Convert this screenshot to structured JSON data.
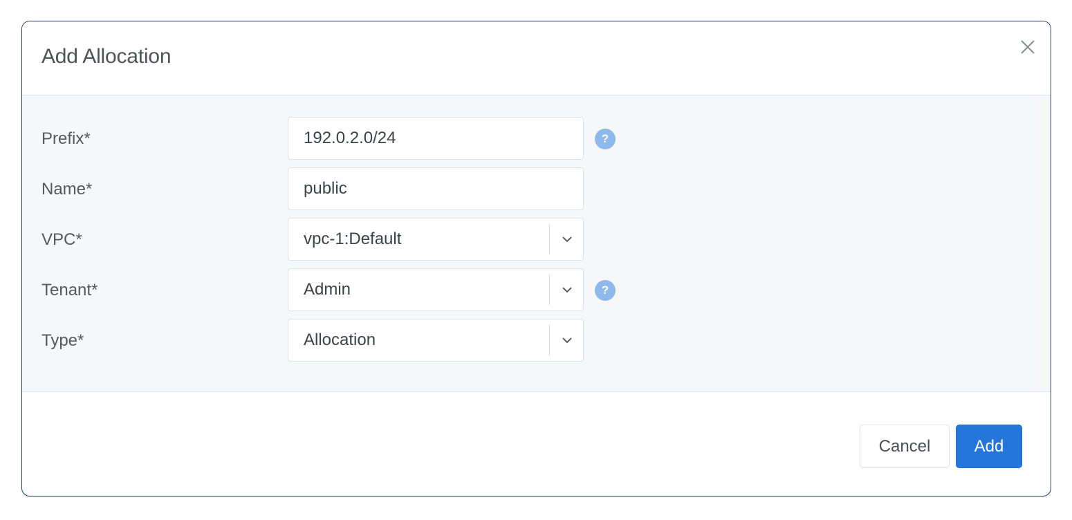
{
  "modal": {
    "title": "Add Allocation",
    "close_icon": "close-icon"
  },
  "form": {
    "prefix": {
      "label": "Prefix*",
      "value": "192.0.2.0/24",
      "help_icon": "question-icon",
      "help_glyph": "?"
    },
    "name": {
      "label": "Name*",
      "value": "public"
    },
    "vpc": {
      "label": "VPC*",
      "value": "vpc-1:Default",
      "chevron_icon": "chevron-down-icon"
    },
    "tenant": {
      "label": "Tenant*",
      "value": "Admin",
      "chevron_icon": "chevron-down-icon",
      "help_icon": "question-icon",
      "help_glyph": "?"
    },
    "type": {
      "label": "Type*",
      "value": "Allocation",
      "chevron_icon": "chevron-down-icon"
    }
  },
  "footer": {
    "cancel_label": "Cancel",
    "add_label": "Add"
  },
  "colors": {
    "primary": "#2575db",
    "help_icon": "#8fb8ec",
    "body_bg": "#f6f7f9",
    "modal_border": "#1f3a63"
  }
}
